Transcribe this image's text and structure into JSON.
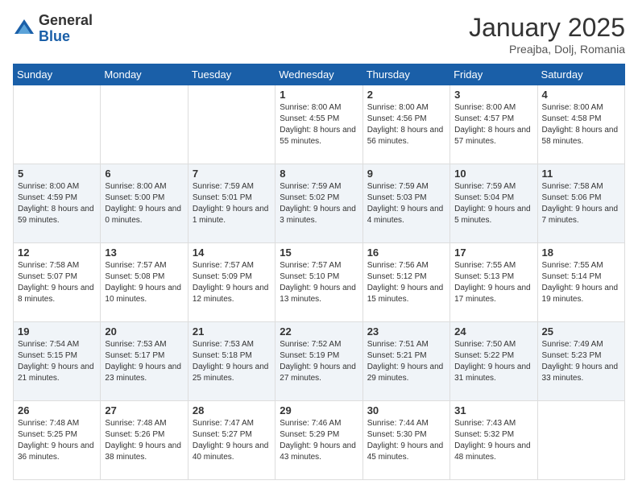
{
  "header": {
    "logo_general": "General",
    "logo_blue": "Blue",
    "month_title": "January 2025",
    "location": "Preajba, Dolj, Romania"
  },
  "weekdays": [
    "Sunday",
    "Monday",
    "Tuesday",
    "Wednesday",
    "Thursday",
    "Friday",
    "Saturday"
  ],
  "weeks": [
    [
      {
        "day": "",
        "content": ""
      },
      {
        "day": "",
        "content": ""
      },
      {
        "day": "",
        "content": ""
      },
      {
        "day": "1",
        "content": "Sunrise: 8:00 AM\nSunset: 4:55 PM\nDaylight: 8 hours\nand 55 minutes."
      },
      {
        "day": "2",
        "content": "Sunrise: 8:00 AM\nSunset: 4:56 PM\nDaylight: 8 hours\nand 56 minutes."
      },
      {
        "day": "3",
        "content": "Sunrise: 8:00 AM\nSunset: 4:57 PM\nDaylight: 8 hours\nand 57 minutes."
      },
      {
        "day": "4",
        "content": "Sunrise: 8:00 AM\nSunset: 4:58 PM\nDaylight: 8 hours\nand 58 minutes."
      }
    ],
    [
      {
        "day": "5",
        "content": "Sunrise: 8:00 AM\nSunset: 4:59 PM\nDaylight: 8 hours\nand 59 minutes."
      },
      {
        "day": "6",
        "content": "Sunrise: 8:00 AM\nSunset: 5:00 PM\nDaylight: 9 hours\nand 0 minutes."
      },
      {
        "day": "7",
        "content": "Sunrise: 7:59 AM\nSunset: 5:01 PM\nDaylight: 9 hours\nand 1 minute."
      },
      {
        "day": "8",
        "content": "Sunrise: 7:59 AM\nSunset: 5:02 PM\nDaylight: 9 hours\nand 3 minutes."
      },
      {
        "day": "9",
        "content": "Sunrise: 7:59 AM\nSunset: 5:03 PM\nDaylight: 9 hours\nand 4 minutes."
      },
      {
        "day": "10",
        "content": "Sunrise: 7:59 AM\nSunset: 5:04 PM\nDaylight: 9 hours\nand 5 minutes."
      },
      {
        "day": "11",
        "content": "Sunrise: 7:58 AM\nSunset: 5:06 PM\nDaylight: 9 hours\nand 7 minutes."
      }
    ],
    [
      {
        "day": "12",
        "content": "Sunrise: 7:58 AM\nSunset: 5:07 PM\nDaylight: 9 hours\nand 8 minutes."
      },
      {
        "day": "13",
        "content": "Sunrise: 7:57 AM\nSunset: 5:08 PM\nDaylight: 9 hours\nand 10 minutes."
      },
      {
        "day": "14",
        "content": "Sunrise: 7:57 AM\nSunset: 5:09 PM\nDaylight: 9 hours\nand 12 minutes."
      },
      {
        "day": "15",
        "content": "Sunrise: 7:57 AM\nSunset: 5:10 PM\nDaylight: 9 hours\nand 13 minutes."
      },
      {
        "day": "16",
        "content": "Sunrise: 7:56 AM\nSunset: 5:12 PM\nDaylight: 9 hours\nand 15 minutes."
      },
      {
        "day": "17",
        "content": "Sunrise: 7:55 AM\nSunset: 5:13 PM\nDaylight: 9 hours\nand 17 minutes."
      },
      {
        "day": "18",
        "content": "Sunrise: 7:55 AM\nSunset: 5:14 PM\nDaylight: 9 hours\nand 19 minutes."
      }
    ],
    [
      {
        "day": "19",
        "content": "Sunrise: 7:54 AM\nSunset: 5:15 PM\nDaylight: 9 hours\nand 21 minutes."
      },
      {
        "day": "20",
        "content": "Sunrise: 7:53 AM\nSunset: 5:17 PM\nDaylight: 9 hours\nand 23 minutes."
      },
      {
        "day": "21",
        "content": "Sunrise: 7:53 AM\nSunset: 5:18 PM\nDaylight: 9 hours\nand 25 minutes."
      },
      {
        "day": "22",
        "content": "Sunrise: 7:52 AM\nSunset: 5:19 PM\nDaylight: 9 hours\nand 27 minutes."
      },
      {
        "day": "23",
        "content": "Sunrise: 7:51 AM\nSunset: 5:21 PM\nDaylight: 9 hours\nand 29 minutes."
      },
      {
        "day": "24",
        "content": "Sunrise: 7:50 AM\nSunset: 5:22 PM\nDaylight: 9 hours\nand 31 minutes."
      },
      {
        "day": "25",
        "content": "Sunrise: 7:49 AM\nSunset: 5:23 PM\nDaylight: 9 hours\nand 33 minutes."
      }
    ],
    [
      {
        "day": "26",
        "content": "Sunrise: 7:48 AM\nSunset: 5:25 PM\nDaylight: 9 hours\nand 36 minutes."
      },
      {
        "day": "27",
        "content": "Sunrise: 7:48 AM\nSunset: 5:26 PM\nDaylight: 9 hours\nand 38 minutes."
      },
      {
        "day": "28",
        "content": "Sunrise: 7:47 AM\nSunset: 5:27 PM\nDaylight: 9 hours\nand 40 minutes."
      },
      {
        "day": "29",
        "content": "Sunrise: 7:46 AM\nSunset: 5:29 PM\nDaylight: 9 hours\nand 43 minutes."
      },
      {
        "day": "30",
        "content": "Sunrise: 7:44 AM\nSunset: 5:30 PM\nDaylight: 9 hours\nand 45 minutes."
      },
      {
        "day": "31",
        "content": "Sunrise: 7:43 AM\nSunset: 5:32 PM\nDaylight: 9 hours\nand 48 minutes."
      },
      {
        "day": "",
        "content": ""
      }
    ]
  ]
}
